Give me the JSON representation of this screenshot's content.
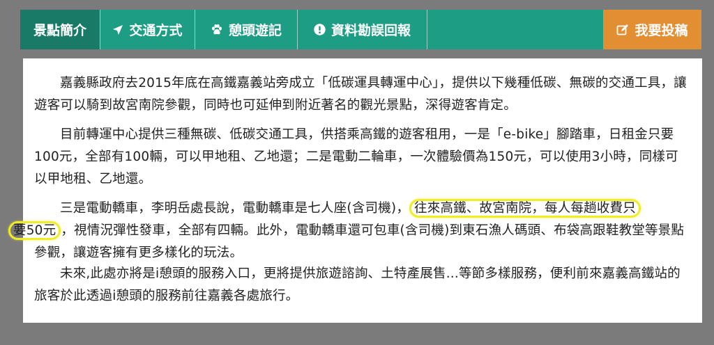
{
  "tabs": [
    {
      "label": "景點簡介",
      "icon": "none",
      "active": true
    },
    {
      "label": "交通方式",
      "icon": "location-arrow-icon",
      "active": false
    },
    {
      "label": "憩頭遊記",
      "icon": "paw-icon",
      "active": false
    },
    {
      "label": "資料勘誤回報",
      "icon": "exclamation-circle-icon",
      "active": false
    }
  ],
  "submit": {
    "label": "我要投稿",
    "icon": "edit-icon"
  },
  "colors": {
    "tab_bg": "#1c9d84",
    "tab_active": "#187a67",
    "submit_bg": "#e28e33",
    "highlight": "#f0ec27"
  },
  "article": {
    "p1": "嘉義縣政府去2015年底在高鐵嘉義站旁成立「低碳運具轉運中心」，提供以下幾種低碳、無碳的交通工具，讓遊客可以騎到故宮南院參觀，同時也可延伸到附近著名的觀光景點，深得遊客肯定。",
    "p2": "目前轉運中心提供三種無碳、低碳交通工具，供搭乘高鐵的遊客租用，一是「e-bike」腳踏車，日租金只要100元，全部有100輛，可以甲地租、乙地還；二是電動二輪車，一次體驗價為150元，可以使用3小時，同樣可以甲地租、乙地還。",
    "p3_before": "三是電動轎車，李明岳處長說，電動轎車是七人座(含司機)，",
    "p3_hl1": "往來高鐵、故宮南院，每人每趟收費只",
    "p3_hl2": "要50元",
    "p3_after": "，視情況彈性發車，全部有四輛。此外，電動轎車還可包車(含司機)到東石漁人碼頭、布袋高跟鞋教堂等景點參觀，讓遊客擁有更多樣化的玩法。",
    "p4": "未來,此處亦將是i憩頭的服務入口，更將提供旅遊諮詢、土特產展售...等節多樣服務，便利前來嘉義高鐵站的旅客於此透過i憩頭的服務前往嘉義各處旅行。"
  }
}
